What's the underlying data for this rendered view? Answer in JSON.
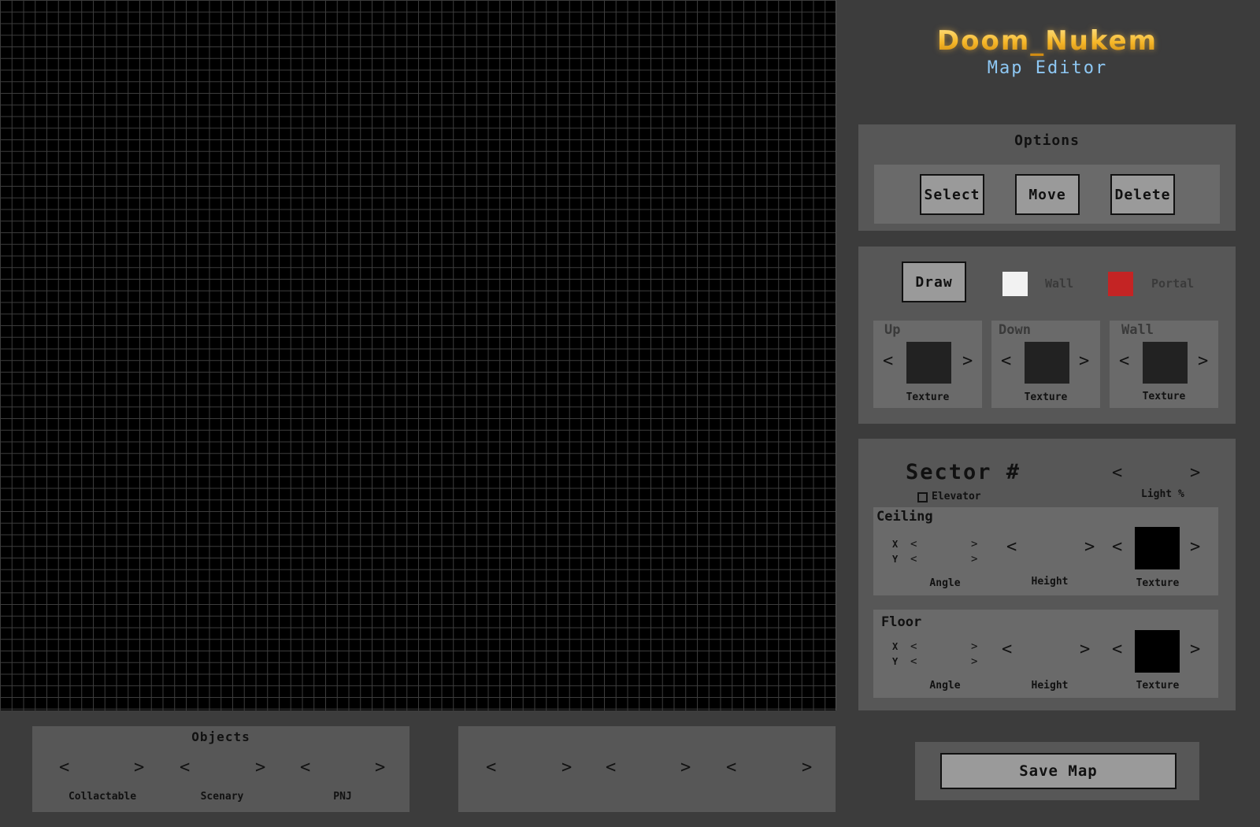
{
  "app": {
    "title": "Doom_Nukem",
    "subtitle": "Map Editor"
  },
  "options": {
    "header": "Options",
    "select_label": "Select",
    "move_label": "Move",
    "delete_label": "Delete"
  },
  "draw": {
    "draw_label": "Draw",
    "wall_label": "Wall",
    "portal_label": "Portal",
    "wall_color": "#f2f2f2",
    "portal_color": "#c42424",
    "textures": [
      {
        "title": "Up",
        "label": "Texture"
      },
      {
        "title": "Down",
        "label": "Texture"
      },
      {
        "title": "Wall",
        "label": "Texture"
      }
    ],
    "prev_glyph": "<",
    "next_glyph": ">"
  },
  "sector": {
    "title": "Sector #",
    "elevator_label": "Elevator",
    "light_label": "Light",
    "light_unit": "%",
    "ceiling": {
      "title": "Ceiling",
      "x_label": "X",
      "y_label": "Y",
      "angle_label": "Angle",
      "height_label": "Height",
      "texture_label": "Texture"
    },
    "floor": {
      "title": "Floor",
      "x_label": "X",
      "y_label": "Y",
      "angle_label": "Angle",
      "height_label": "Height",
      "texture_label": "Texture"
    }
  },
  "objects": {
    "header": "Objects",
    "categories": [
      "Collactable",
      "Scenary",
      "PNJ"
    ]
  },
  "save": {
    "label": "Save Map"
  }
}
